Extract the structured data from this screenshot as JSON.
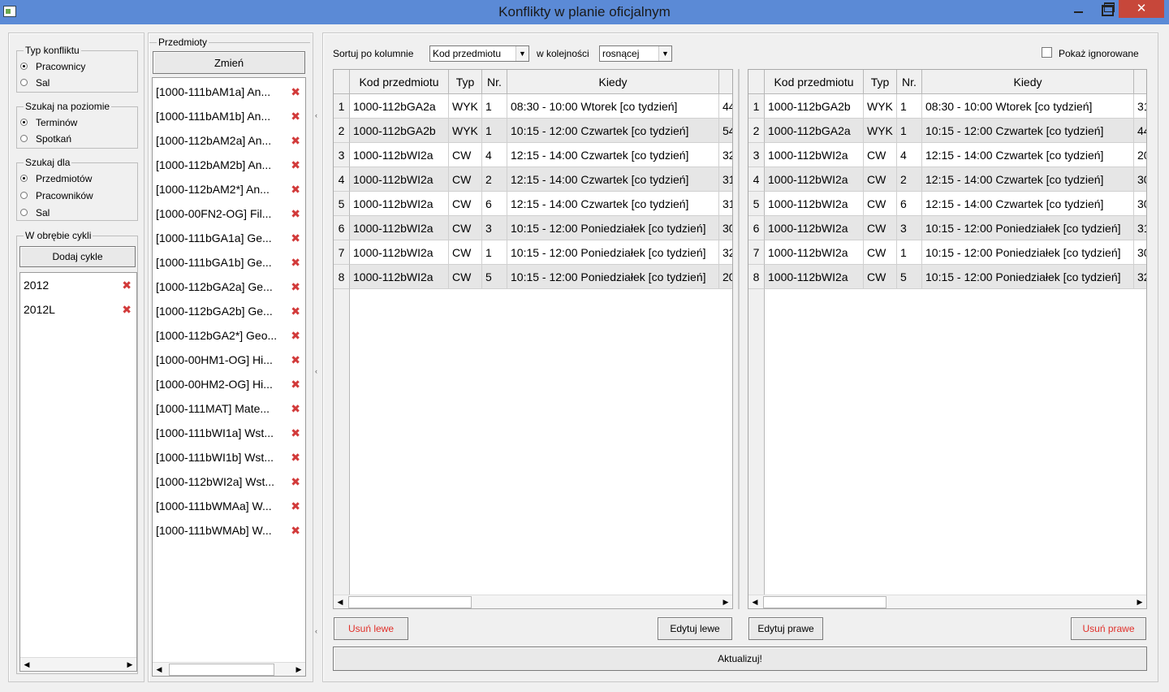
{
  "window": {
    "title": "Konflikty w planie oficjalnym"
  },
  "filters": {
    "conflict_type": {
      "label": "Typ konfliktu",
      "options": [
        "Pracownicy",
        "Sal"
      ],
      "selected": "Pracownicy"
    },
    "search_level": {
      "label": "Szukaj na poziomie",
      "options": [
        "Terminów",
        "Spotkań"
      ],
      "selected": "Terminów"
    },
    "search_for": {
      "label": "Szukaj dla",
      "options": [
        "Przedmiotów",
        "Pracowników",
        "Sal"
      ],
      "selected": "Przedmiotów"
    },
    "cycles": {
      "label": "W obrębie cykli",
      "add_button": "Dodaj cykle",
      "items": [
        "2012",
        "2012L"
      ]
    }
  },
  "subjects": {
    "label": "Przedmioty",
    "change_button": "Zmień",
    "items": [
      "[1000-111bAM1a] An...",
      "[1000-111bAM1b] An...",
      "[1000-112bAM2a] An...",
      "[1000-112bAM2b] An...",
      "[1000-112bAM2*] An...",
      "[1000-00FN2-OG] Fil...",
      "[1000-111bGA1a] Ge...",
      "[1000-111bGA1b] Ge...",
      "[1000-112bGA2a] Ge...",
      "[1000-112bGA2b] Ge...",
      "[1000-112bGA2*] Geo...",
      "[1000-00HM1-OG] Hi...",
      "[1000-00HM2-OG] Hi...",
      "[1000-111MAT] Mate...",
      "[1000-111bWI1a] Wst...",
      "[1000-111bWI1b] Wst...",
      "[1000-112bWI2a] Wst...",
      "[1000-111bWMAa] W...",
      "[1000-111bWMAb] W..."
    ]
  },
  "sorting": {
    "sort_label": "Sortuj po kolumnie",
    "sort_value": "Kod przedmiotu",
    "order_label": "w kolejności",
    "order_value": "rosnącej",
    "show_ignored_label": "Pokaż ignorowane"
  },
  "columns": [
    "Kod przedmiotu",
    "Typ",
    "Nr.",
    "Kiedy"
  ],
  "left_table": {
    "rows": [
      [
        "1000-112bGA2a",
        "WYK",
        "1",
        "08:30 - 10:00 Wtorek [co tydzień]",
        "44"
      ],
      [
        "1000-112bGA2b",
        "WYK",
        "1",
        "10:15 - 12:00 Czwartek [co tydzień]",
        "54"
      ],
      [
        "1000-112bWI2a",
        "CW",
        "4",
        "12:15 - 14:00 Czwartek [co tydzień]",
        "32"
      ],
      [
        "1000-112bWI2a",
        "CW",
        "2",
        "12:15 - 14:00 Czwartek [co tydzień]",
        "31"
      ],
      [
        "1000-112bWI2a",
        "CW",
        "6",
        "12:15 - 14:00 Czwartek [co tydzień]",
        "31"
      ],
      [
        "1000-112bWI2a",
        "CW",
        "3",
        "10:15 - 12:00 Poniedziałek [co tydzień]",
        "30"
      ],
      [
        "1000-112bWI2a",
        "CW",
        "1",
        "10:15 - 12:00 Poniedziałek [co tydzień]",
        "32"
      ],
      [
        "1000-112bWI2a",
        "CW",
        "5",
        "10:15 - 12:00 Poniedziałek [co tydzień]",
        "20"
      ]
    ]
  },
  "right_table": {
    "rows": [
      [
        "1000-112bGA2b",
        "WYK",
        "1",
        "08:30 - 10:00 Wtorek [co tydzień]",
        "31"
      ],
      [
        "1000-112bGA2a",
        "WYK",
        "1",
        "10:15 - 12:00 Czwartek [co tydzień]",
        "44"
      ],
      [
        "1000-112bWI2a",
        "CW",
        "4",
        "12:15 - 14:00 Czwartek [co tydzień]",
        "20"
      ],
      [
        "1000-112bWI2a",
        "CW",
        "2",
        "12:15 - 14:00 Czwartek [co tydzień]",
        "30"
      ],
      [
        "1000-112bWI2a",
        "CW",
        "6",
        "12:15 - 14:00 Czwartek [co tydzień]",
        "30"
      ],
      [
        "1000-112bWI2a",
        "CW",
        "3",
        "10:15 - 12:00 Poniedziałek [co tydzień]",
        "31"
      ],
      [
        "1000-112bWI2a",
        "CW",
        "1",
        "10:15 - 12:00 Poniedziałek [co tydzień]",
        "30"
      ],
      [
        "1000-112bWI2a",
        "CW",
        "5",
        "10:15 - 12:00 Poniedziałek [co tydzień]",
        "32"
      ]
    ]
  },
  "buttons": {
    "remove_left": "Usuń lewe",
    "edit_left": "Edytuj lewe",
    "edit_right": "Edytuj prawe",
    "remove_right": "Usuń prawe",
    "refresh": "Aktualizuj!"
  },
  "colors": {
    "titlebar": "#5b8ad6",
    "remove_red": "#e0302a",
    "alt_row": "#e6e6e6"
  }
}
